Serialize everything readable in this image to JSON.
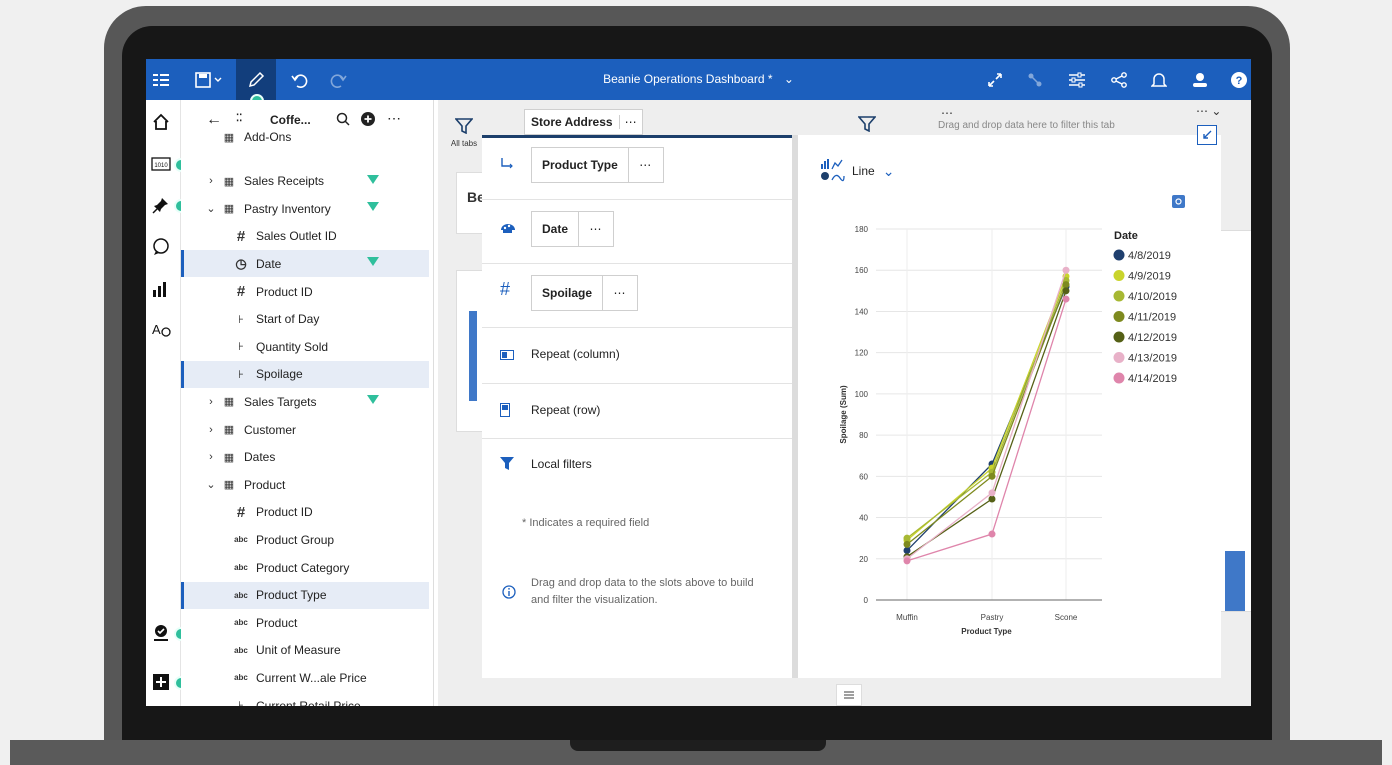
{
  "topbar": {
    "title": "Beanie Operations Dashboard *",
    "accent": "#1c5fbd"
  },
  "datapanel": {
    "source_name": "Coffe...",
    "items": [
      {
        "label": "Add-Ons",
        "icon": "table-icon",
        "level": 1
      },
      {
        "label": "Sales Receipts",
        "icon": "table-icon",
        "level": 0,
        "expanded": false,
        "filter": true
      },
      {
        "label": "Pastry Inventory",
        "icon": "table-icon",
        "level": 0,
        "expanded": true,
        "filter": true
      },
      {
        "label": "Sales Outlet ID",
        "icon": "hash-icon",
        "level": 1
      },
      {
        "label": "Date",
        "icon": "clock-icon",
        "level": 1,
        "selected": true,
        "filter": true
      },
      {
        "label": "Product ID",
        "icon": "hash-icon",
        "level": 1
      },
      {
        "label": "Start of Day",
        "icon": "measure-icon",
        "level": 1
      },
      {
        "label": "Quantity Sold",
        "icon": "measure-icon",
        "level": 1
      },
      {
        "label": "Spoilage",
        "icon": "measure-icon",
        "level": 1,
        "selected": true
      },
      {
        "label": "Sales Targets",
        "icon": "table-icon",
        "level": 0,
        "expanded": false,
        "filter": true
      },
      {
        "label": "Customer",
        "icon": "table-icon",
        "level": 0,
        "expanded": false
      },
      {
        "label": "Dates",
        "icon": "table-icon",
        "level": 0,
        "expanded": false
      },
      {
        "label": "Product",
        "icon": "table-icon",
        "level": 0,
        "expanded": true
      },
      {
        "label": "Product ID",
        "icon": "hash-icon",
        "level": 1
      },
      {
        "label": "Product Group",
        "icon": "abc-icon",
        "level": 1
      },
      {
        "label": "Product Category",
        "icon": "abc-icon",
        "level": 1
      },
      {
        "label": "Product Type",
        "icon": "abc-icon",
        "level": 1,
        "selected": true
      },
      {
        "label": "Product",
        "icon": "abc-icon",
        "level": 1
      },
      {
        "label": "Unit of Measure",
        "icon": "abc-icon",
        "level": 1
      },
      {
        "label": "Current W...ale Price",
        "icon": "abc-icon",
        "level": 1
      },
      {
        "label": "Current Retail Price",
        "icon": "measure-icon",
        "level": 1
      }
    ]
  },
  "canvas": {
    "all_tabs_label": "All tabs",
    "store_address_chip": "Store Address",
    "drop_hint": "Drag and drop data here to filter this tab",
    "partial_title": "Be"
  },
  "editor": {
    "slots": [
      {
        "icon": "x-axis-icon",
        "chip": "Product Type"
      },
      {
        "icon": "color-icon",
        "chip": "Date"
      },
      {
        "icon": "hash-icon",
        "chip": "Spoilage"
      }
    ],
    "repeat_column": "Repeat (column)",
    "repeat_row": "Repeat (row)",
    "local_filters": "Local filters",
    "required_note": "* Indicates a required field",
    "drag_hint": "Drag and drop data to the slots above to build and filter the visualization.",
    "chip_more": "⋯"
  },
  "visualization": {
    "type_label": "Line",
    "legend_title": "Date"
  },
  "chart_data": {
    "type": "line",
    "categories": [
      "Muffin",
      "Pastry",
      "Scone"
    ],
    "xlabel": "Product Type",
    "ylabel": "Spoilage (Sum)",
    "ylim": [
      0,
      180
    ],
    "yticks": [
      0,
      20,
      40,
      60,
      80,
      100,
      120,
      140,
      160,
      180
    ],
    "grid": true,
    "legend_title": "Date",
    "legend_position": "right",
    "series": [
      {
        "name": "4/8/2019",
        "color": "#1f3f6e",
        "values": [
          24,
          66,
          152
        ]
      },
      {
        "name": "4/9/2019",
        "color": "#c9d42c",
        "values": [
          29,
          64,
          157
        ]
      },
      {
        "name": "4/10/2019",
        "color": "#a7b833",
        "values": [
          30,
          62,
          155
        ]
      },
      {
        "name": "4/11/2019",
        "color": "#7e8a1f",
        "values": [
          27,
          60,
          153
        ]
      },
      {
        "name": "4/12/2019",
        "color": "#556016",
        "values": [
          21,
          49,
          150
        ]
      },
      {
        "name": "4/13/2019",
        "color": "#e8b1c8",
        "values": [
          20,
          52,
          160
        ]
      },
      {
        "name": "4/14/2019",
        "color": "#df85ab",
        "values": [
          19,
          32,
          146
        ]
      }
    ]
  }
}
